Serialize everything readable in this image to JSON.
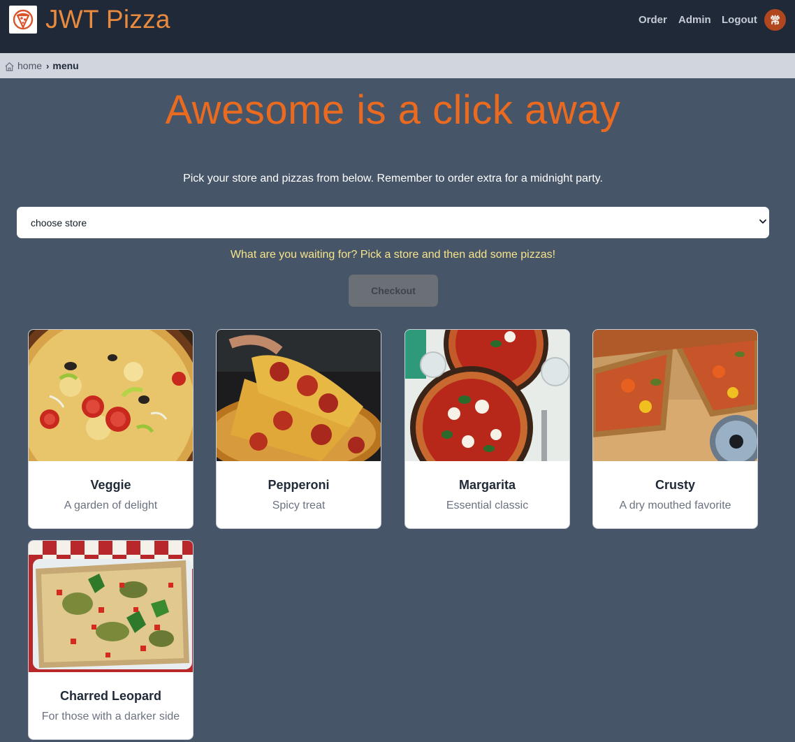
{
  "header": {
    "brand": "JWT Pizza",
    "nav": [
      "Order",
      "Admin",
      "Logout"
    ],
    "avatar_initial": "常",
    "logo_icon": "pizza-slice-icon"
  },
  "breadcrumb": {
    "home": "home",
    "current": "menu"
  },
  "main": {
    "title": "Awesome is a click away",
    "subtitle": "Pick your store and pizzas from below. Remember to order extra for a midnight party.",
    "store_select_value": "choose store",
    "prompt": "What are you waiting for? Pick a store and then add some pizzas!",
    "checkout_label": "Checkout"
  },
  "pizzas": [
    {
      "name": "Veggie",
      "description": "A garden of delight"
    },
    {
      "name": "Pepperoni",
      "description": "Spicy treat"
    },
    {
      "name": "Margarita",
      "description": "Essential classic"
    },
    {
      "name": "Crusty",
      "description": "A dry mouthed favorite"
    },
    {
      "name": "Charred Leopard",
      "description": "For those with a darker side"
    }
  ],
  "colors": {
    "header_bg": "#1f2937",
    "page_bg": "#475569",
    "brand_orange": "#ea8a3f",
    "hero_orange": "#ea6a20",
    "prompt_yellow": "#f6e58a",
    "breadcrumb_bg": "#d1d5de"
  }
}
